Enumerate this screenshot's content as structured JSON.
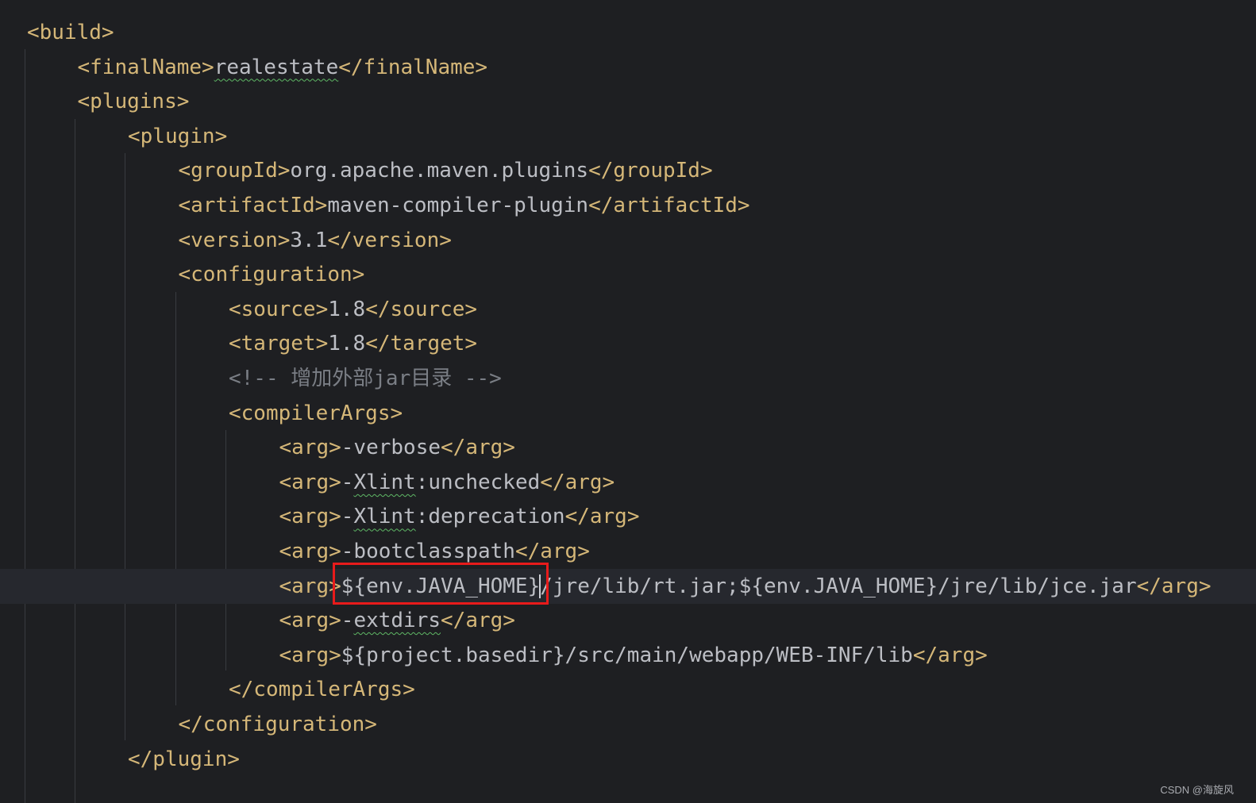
{
  "editor": {
    "lines": [
      {
        "segments": [
          {
            "k": "tag",
            "t": "<build>"
          }
        ]
      },
      {
        "segments": [
          {
            "k": "tag",
            "t": "<finalName>"
          },
          {
            "k": "txt",
            "t": "realestate",
            "sq": true
          },
          {
            "k": "tag",
            "t": "</finalName>"
          }
        ]
      },
      {
        "segments": [
          {
            "k": "tag",
            "t": "<plugins>"
          }
        ]
      },
      {
        "segments": [
          {
            "k": "tag",
            "t": "<plugin>"
          }
        ]
      },
      {
        "segments": [
          {
            "k": "tag",
            "t": "<groupId>"
          },
          {
            "k": "txt",
            "t": "org.apache.maven.plugins"
          },
          {
            "k": "tag",
            "t": "</groupId>"
          }
        ]
      },
      {
        "segments": [
          {
            "k": "tag",
            "t": "<artifactId>"
          },
          {
            "k": "txt",
            "t": "maven-compiler-plugin"
          },
          {
            "k": "tag",
            "t": "</artifactId>"
          }
        ]
      },
      {
        "segments": [
          {
            "k": "tag",
            "t": "<version>"
          },
          {
            "k": "txt",
            "t": "3.1"
          },
          {
            "k": "tag",
            "t": "</version>"
          }
        ]
      },
      {
        "segments": [
          {
            "k": "tag",
            "t": "<configuration>"
          }
        ]
      },
      {
        "segments": [
          {
            "k": "tag",
            "t": "<source>"
          },
          {
            "k": "txt",
            "t": "1.8"
          },
          {
            "k": "tag",
            "t": "</source>"
          }
        ]
      },
      {
        "segments": [
          {
            "k": "tag",
            "t": "<target>"
          },
          {
            "k": "txt",
            "t": "1.8"
          },
          {
            "k": "tag",
            "t": "</target>"
          }
        ]
      },
      {
        "segments": [
          {
            "k": "cmt",
            "t": "<!-- 增加外部jar目录 -->"
          }
        ]
      },
      {
        "segments": [
          {
            "k": "tag",
            "t": "<compilerArgs>"
          }
        ]
      },
      {
        "segments": [
          {
            "k": "tag",
            "t": "<arg>"
          },
          {
            "k": "txt",
            "t": "-verbose"
          },
          {
            "k": "tag",
            "t": "</arg>"
          }
        ]
      },
      {
        "segments": [
          {
            "k": "tag",
            "t": "<arg>"
          },
          {
            "k": "txt",
            "t": "-"
          },
          {
            "k": "txt",
            "t": "Xlint",
            "sq": true
          },
          {
            "k": "txt",
            "t": ":unchecked"
          },
          {
            "k": "tag",
            "t": "</arg>"
          }
        ]
      },
      {
        "segments": [
          {
            "k": "tag",
            "t": "<arg>"
          },
          {
            "k": "txt",
            "t": "-"
          },
          {
            "k": "txt",
            "t": "Xlint",
            "sq": true
          },
          {
            "k": "txt",
            "t": ":deprecation"
          },
          {
            "k": "tag",
            "t": "</arg>"
          }
        ]
      },
      {
        "segments": [
          {
            "k": "tag",
            "t": "<arg>"
          },
          {
            "k": "txt",
            "t": "-bootclasspath"
          },
          {
            "k": "tag",
            "t": "</arg>"
          }
        ]
      },
      {
        "current": true,
        "segments": [
          {
            "k": "tag",
            "t": "<arg>"
          },
          {
            "k": "txt",
            "t": "${env.JAVA_HOME}"
          },
          {
            "k": "caret"
          },
          {
            "k": "txt",
            "t": "/jre/lib/rt.jar;${env.JAVA_HOME}/jre/lib/jce.jar"
          },
          {
            "k": "tag",
            "t": "</arg>"
          }
        ]
      },
      {
        "segments": [
          {
            "k": "tag",
            "t": "<arg>"
          },
          {
            "k": "txt",
            "t": "-"
          },
          {
            "k": "txt",
            "t": "extdirs",
            "sq": true
          },
          {
            "k": "tag",
            "t": "</arg>"
          }
        ]
      },
      {
        "segments": [
          {
            "k": "tag",
            "t": "<arg>"
          },
          {
            "k": "txt",
            "t": "${project.basedir}/src/main/webapp/WEB-INF/lib"
          },
          {
            "k": "tag",
            "t": "</arg>"
          }
        ]
      },
      {
        "segments": [
          {
            "k": "tag",
            "t": "</compilerArgs>"
          }
        ]
      },
      {
        "segments": [
          {
            "k": "tag",
            "t": "</configuration>"
          }
        ]
      },
      {
        "segments": [
          {
            "k": "tag",
            "t": "</plugin>"
          }
        ]
      }
    ]
  },
  "colors": {
    "background": "#1e1f22",
    "tag": "#d5b778",
    "text": "#bcbec4",
    "comment": "#7a7e85",
    "highlight": "#e81b1b"
  },
  "watermark": "CSDN @海旋风"
}
